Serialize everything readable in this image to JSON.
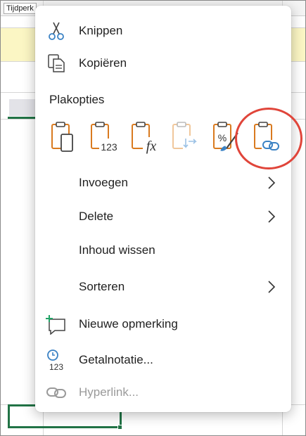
{
  "background": {
    "tab_label": "Tijdperk",
    "top_icons": [
      "▸",
      "◂",
      "⊟"
    ]
  },
  "menu": {
    "cut_label": "Knippen",
    "copy_label": "Kopiëren",
    "paste_options_title": "Plakopties",
    "paste_options": [
      {
        "name": "paste-keep-source-icon"
      },
      {
        "name": "paste-values-icon",
        "text": "123"
      },
      {
        "name": "paste-formulas-icon",
        "text": "fx"
      },
      {
        "name": "paste-transpose-icon"
      },
      {
        "name": "paste-formatting-icon"
      },
      {
        "name": "paste-link-icon"
      }
    ],
    "insert_label": "Invoegen",
    "delete_label": "Delete",
    "clear_label": "Inhoud wissen",
    "sort_label": "Sorteren",
    "new_comment_label": "Nieuwe opmerking",
    "number_format_label": "Getalnotatie...",
    "number_format_icon_text": "123",
    "hyperlink_label": "Hyperlink..."
  },
  "colors": {
    "accent_orange": "#d97a1f",
    "excel_green": "#217346",
    "icon_blue": "#3b82c4",
    "ring_red": "#e0453a"
  }
}
